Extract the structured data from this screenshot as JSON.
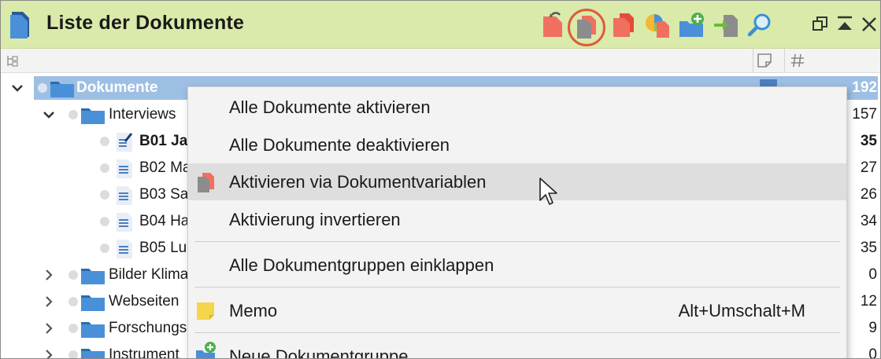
{
  "window": {
    "title": "Liste der Dokumente"
  },
  "toolbar": {
    "icons": [
      "document-reset-icon",
      "activate-via-variables-icon",
      "activate-documents-icon",
      "chart-documents-icon",
      "new-document-group-icon",
      "import-document-icon",
      "search-icon"
    ],
    "highlighted": "activate-via-variables-icon",
    "highlight_color": "#e05a3a"
  },
  "tree": [
    {
      "label": "Dokumente",
      "count": "192",
      "level": 0,
      "type": "folder",
      "expanded": true,
      "selected": true
    },
    {
      "label": "Interviews",
      "count": "157",
      "level": 1,
      "type": "folder",
      "expanded": true
    },
    {
      "label": "B01 Ja",
      "count": "35",
      "level": 2,
      "type": "doc",
      "bold": true,
      "edited": true
    },
    {
      "label": "B02 Ma",
      "count": "27",
      "level": 2,
      "type": "doc"
    },
    {
      "label": "B03 Sa",
      "count": "26",
      "level": 2,
      "type": "doc"
    },
    {
      "label": "B04 Ha",
      "count": "34",
      "level": 2,
      "type": "doc"
    },
    {
      "label": "B05 Lu",
      "count": "35",
      "level": 2,
      "type": "doc"
    },
    {
      "label": "Bilder Klima",
      "count": "0",
      "level": 1,
      "type": "folder",
      "expanded": false
    },
    {
      "label": "Webseiten",
      "count": "12",
      "level": 1,
      "type": "folder",
      "expanded": false
    },
    {
      "label": "Forschungs",
      "count": "9",
      "level": 1,
      "type": "folder",
      "expanded": false
    },
    {
      "label": "Instrument",
      "count": "0",
      "level": 1,
      "type": "folder",
      "expanded": false
    }
  ],
  "context_menu": {
    "items": [
      {
        "label": "Alle Dokumente aktivieren",
        "shortcut": ""
      },
      {
        "label": "Alle Dokumente deaktivieren",
        "shortcut": ""
      },
      {
        "label": "Aktivieren via Dokumentvariablen",
        "shortcut": "",
        "hover": true,
        "icon": "activate-via-variables-icon"
      },
      {
        "label": "Aktivierung invertieren",
        "shortcut": ""
      },
      {
        "label": "Alle Dokumentgruppen einklappen",
        "shortcut": ""
      },
      {
        "label": "Memo",
        "shortcut": "Alt+Umschalt+M",
        "icon": "memo-icon"
      },
      {
        "label": "Neue Dokumentgruppe",
        "shortcut": "",
        "icon": "new-document-group-icon"
      }
    ]
  },
  "colors": {
    "titlebar": "#d9eaaa",
    "selection": "#9dbfe3",
    "folder": "#4a90d9",
    "menu_bg": "#f3f3f3",
    "menu_hover": "#dedede"
  }
}
